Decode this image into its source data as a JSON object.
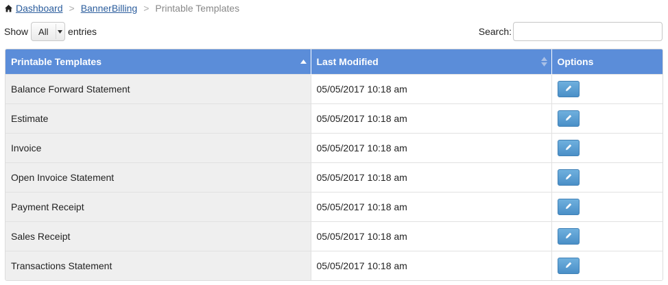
{
  "breadcrumb": {
    "home_icon": "home-icon",
    "items": [
      "Dashboard",
      "BannerBilling"
    ],
    "separator": ">",
    "current": "Printable Templates"
  },
  "length_control": {
    "prefix": "Show",
    "selected": "All",
    "suffix": "entries"
  },
  "search": {
    "label": "Search:",
    "value": ""
  },
  "table": {
    "header_color": "#5b8dd9",
    "columns": [
      "Printable Templates",
      "Last Modified",
      "Options"
    ],
    "rows": [
      {
        "name": "Balance Forward Statement",
        "modified": "05/05/2017 10:18 am",
        "action_icon": "pencil-icon"
      },
      {
        "name": "Estimate",
        "modified": "05/05/2017 10:18 am",
        "action_icon": "pencil-icon"
      },
      {
        "name": "Invoice",
        "modified": "05/05/2017 10:18 am",
        "action_icon": "pencil-icon"
      },
      {
        "name": "Open Invoice Statement",
        "modified": "05/05/2017 10:18 am",
        "action_icon": "pencil-icon"
      },
      {
        "name": "Payment Receipt",
        "modified": "05/05/2017 10:18 am",
        "action_icon": "pencil-icon"
      },
      {
        "name": "Sales Receipt",
        "modified": "05/05/2017 10:18 am",
        "action_icon": "pencil-icon"
      },
      {
        "name": "Transactions Statement",
        "modified": "05/05/2017 10:18 am",
        "action_icon": "pencil-icon"
      }
    ]
  }
}
